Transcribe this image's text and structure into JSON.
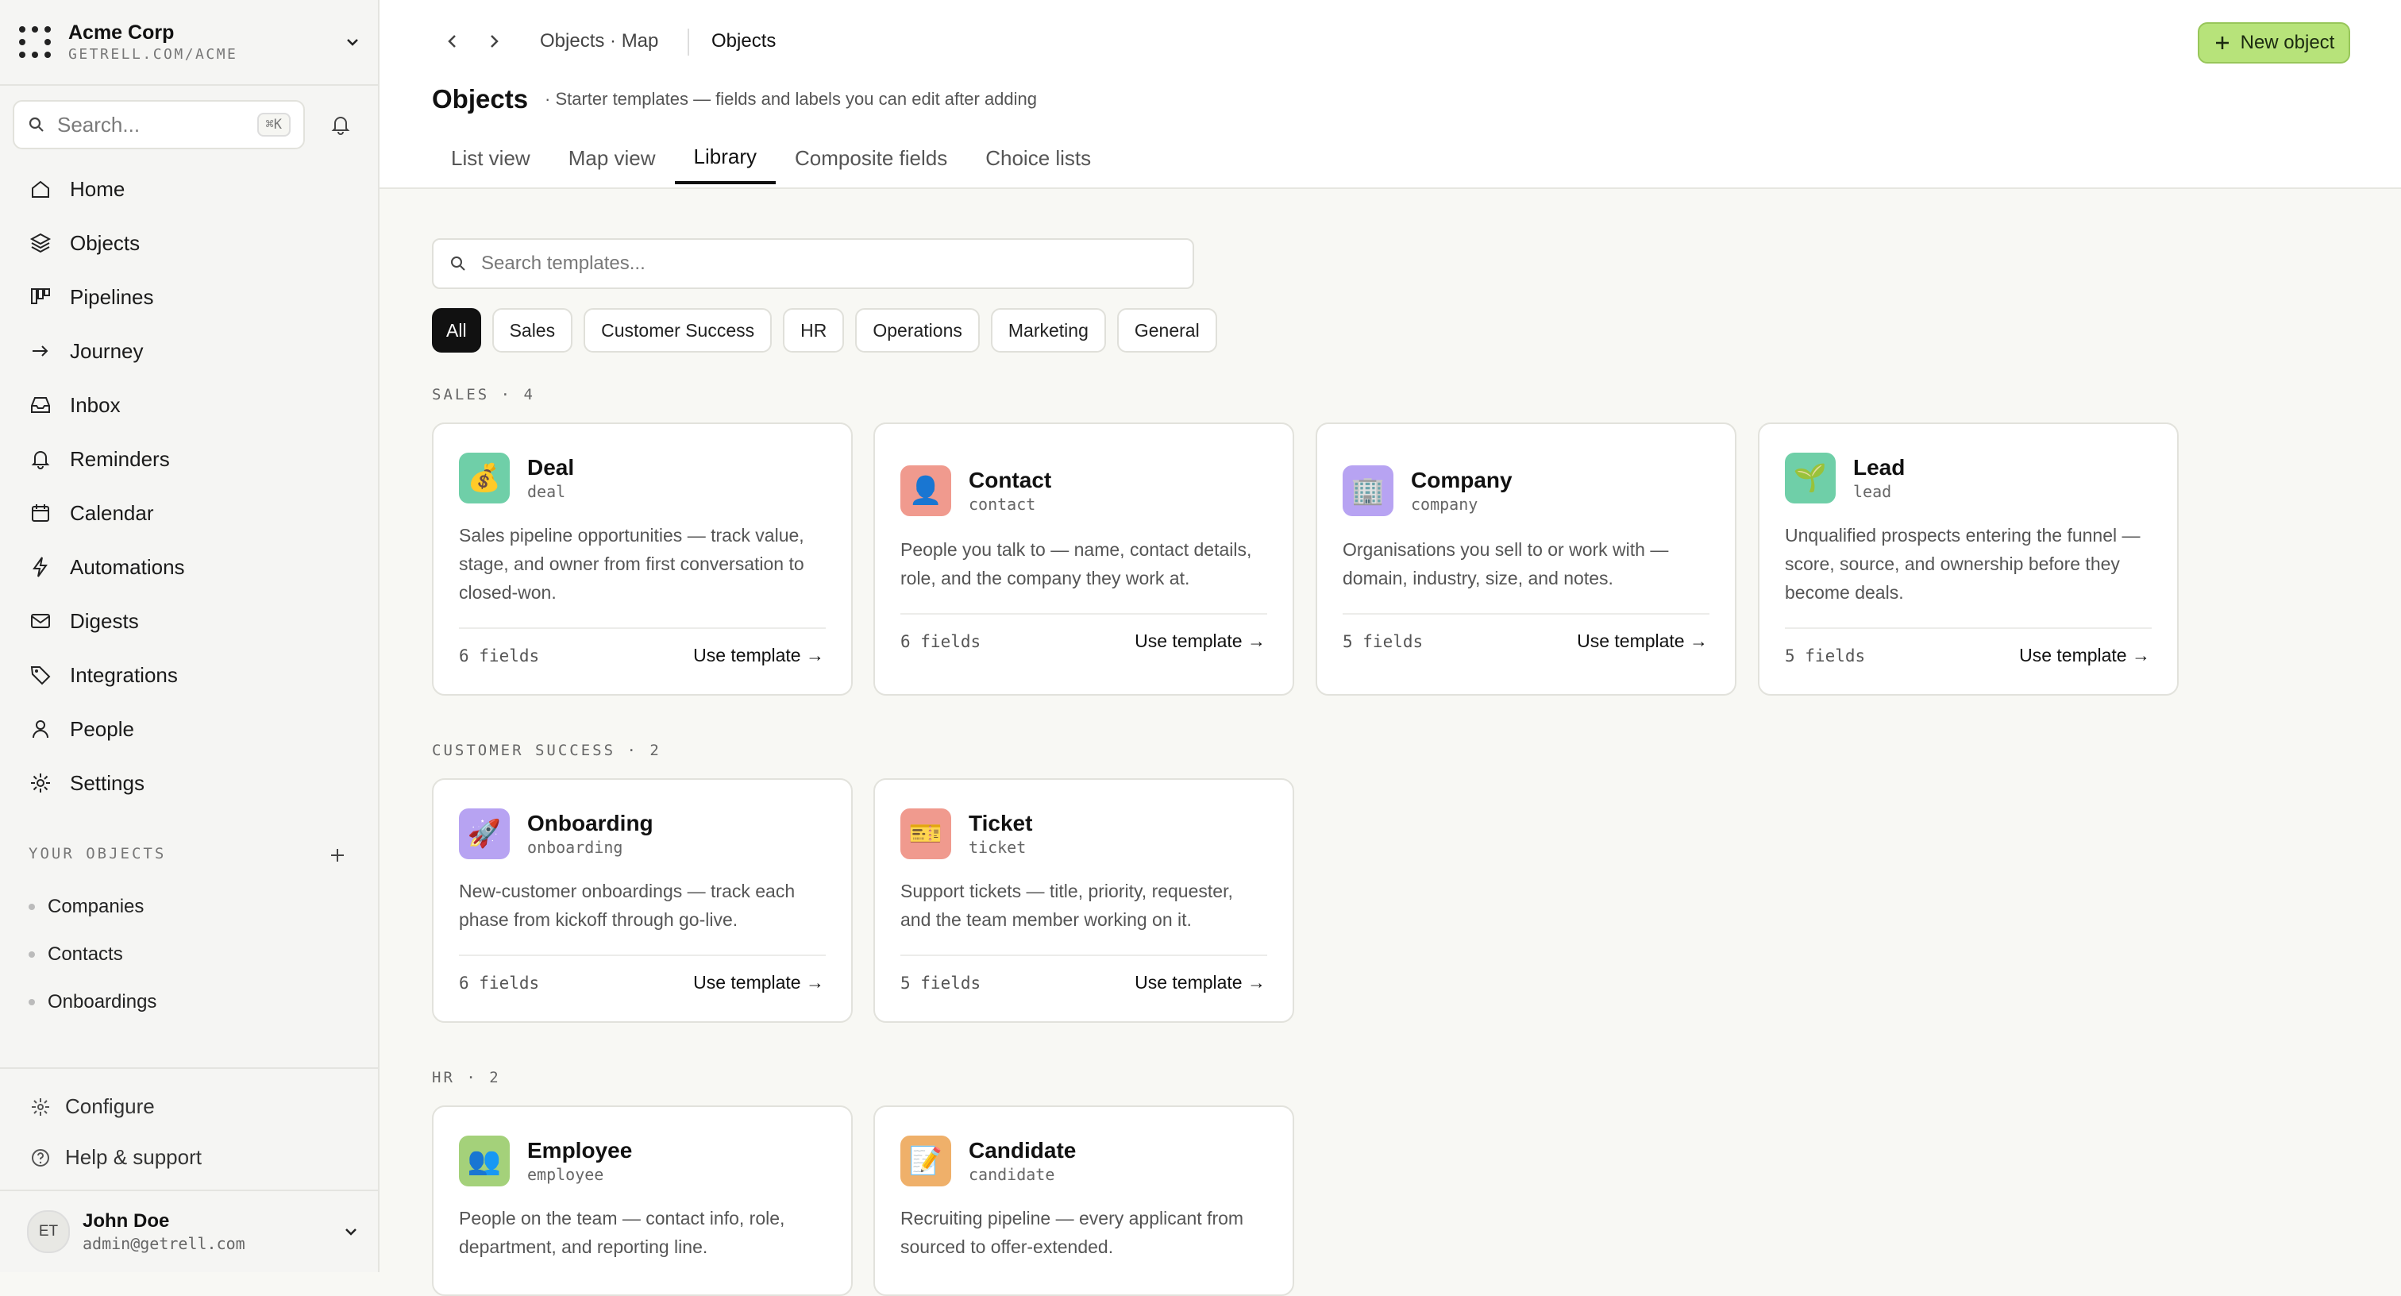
{
  "org": {
    "name": "Acme Corp",
    "url": "GETRELL.COM/ACME"
  },
  "search": {
    "placeholder": "Search...",
    "shortcut": "⌘K"
  },
  "nav": [
    {
      "label": "Home",
      "icon": "home-icon"
    },
    {
      "label": "Objects",
      "icon": "layers-icon"
    },
    {
      "label": "Pipelines",
      "icon": "kanban-icon"
    },
    {
      "label": "Journey",
      "icon": "arrow-right-icon"
    },
    {
      "label": "Inbox",
      "icon": "inbox-icon"
    },
    {
      "label": "Reminders",
      "icon": "bell-icon"
    },
    {
      "label": "Calendar",
      "icon": "calendar-icon"
    },
    {
      "label": "Automations",
      "icon": "bolt-icon"
    },
    {
      "label": "Digests",
      "icon": "mail-icon"
    },
    {
      "label": "Integrations",
      "icon": "tag-icon"
    },
    {
      "label": "People",
      "icon": "user-icon"
    },
    {
      "label": "Settings",
      "icon": "gear-icon"
    }
  ],
  "your_objects": {
    "label": "YOUR OBJECTS",
    "items": [
      "Companies",
      "Contacts",
      "Onboardings"
    ]
  },
  "footer": {
    "configure": "Configure",
    "help": "Help & support"
  },
  "user": {
    "initials": "ET",
    "name": "John Doe",
    "email": "admin@getrell.com"
  },
  "breadcrumb": {
    "parent": "Objects · Map",
    "current": "Objects"
  },
  "new_button": "New object",
  "page": {
    "title": "Objects",
    "subtitle": "· Starter templates — fields and labels you can edit after adding"
  },
  "tabs": [
    "List view",
    "Map view",
    "Library",
    "Composite fields",
    "Choice lists"
  ],
  "active_tab": "Library",
  "template_search": {
    "placeholder": "Search templates..."
  },
  "filters": [
    "All",
    "Sales",
    "Customer Success",
    "HR",
    "Operations",
    "Marketing",
    "General"
  ],
  "active_filter": "All",
  "groups": [
    {
      "label": "SALES · 4",
      "cards": [
        {
          "title": "Deal",
          "slug": "deal",
          "emoji": "💰",
          "color": "#6fcfa8",
          "desc": "Sales pipeline opportunities — track value, stage, and owner from first conversation to closed-won.",
          "fields": "6 fields",
          "action": "Use template →"
        },
        {
          "title": "Contact",
          "slug": "contact",
          "emoji": "👤",
          "color": "#f09a8e",
          "desc": "People you talk to — name, contact details, role, and the company they work at.",
          "fields": "6 fields",
          "action": "Use template →"
        },
        {
          "title": "Company",
          "slug": "company",
          "emoji": "🏢",
          "color": "#b7a3f2",
          "desc": "Organisations you sell to or work with — domain, industry, size, and notes.",
          "fields": "5 fields",
          "action": "Use template →"
        },
        {
          "title": "Lead",
          "slug": "lead",
          "emoji": "🌱",
          "color": "#6fcfa8",
          "desc": "Unqualified prospects entering the funnel — score, source, and ownership before they become deals.",
          "fields": "5 fields",
          "action": "Use template →"
        }
      ]
    },
    {
      "label": "CUSTOMER SUCCESS · 2",
      "cards": [
        {
          "title": "Onboarding",
          "slug": "onboarding",
          "emoji": "🚀",
          "color": "#b7a3f2",
          "desc": "New-customer onboardings — track each phase from kickoff through go-live.",
          "fields": "6 fields",
          "action": "Use template →"
        },
        {
          "title": "Ticket",
          "slug": "ticket",
          "emoji": "🎫",
          "color": "#f09a8e",
          "desc": "Support tickets — title, priority, requester, and the team member working on it.",
          "fields": "5 fields",
          "action": "Use template →"
        }
      ]
    },
    {
      "label": "HR · 2",
      "cards": [
        {
          "title": "Employee",
          "slug": "employee",
          "emoji": "👥",
          "color": "#a4d17a",
          "desc": "People on the team — contact info, role, department, and reporting line.",
          "fields": "",
          "action": ""
        },
        {
          "title": "Candidate",
          "slug": "candidate",
          "emoji": "📝",
          "color": "#efb06a",
          "desc": "Recruiting pipeline — every applicant from sourced to offer-extended.",
          "fields": "",
          "action": ""
        }
      ]
    }
  ]
}
